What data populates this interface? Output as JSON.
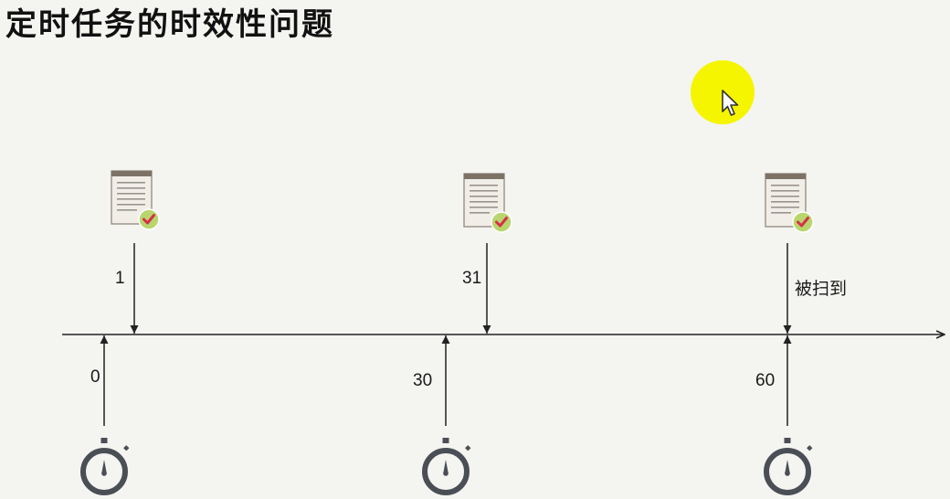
{
  "title": "定时任务的时效性问题",
  "timeline": {
    "tasks": [
      {
        "label": "1",
        "icon": "document-check-icon"
      },
      {
        "label": "31",
        "icon": "document-check-icon"
      },
      {
        "label": "被扫到",
        "icon": "document-check-icon"
      }
    ],
    "timers": [
      {
        "label": "0",
        "icon": "stopwatch-icon"
      },
      {
        "label": "30",
        "icon": "stopwatch-icon"
      },
      {
        "label": "60",
        "icon": "stopwatch-icon"
      }
    ]
  },
  "pointer": {
    "icon": "mouse-cursor-icon"
  },
  "colors": {
    "background": "#f4f4f1",
    "highlight": "#f5f500",
    "line": "#222222",
    "icon_dark": "#4a4f55",
    "badge": "#b9d66e",
    "check": "#d6304a"
  }
}
